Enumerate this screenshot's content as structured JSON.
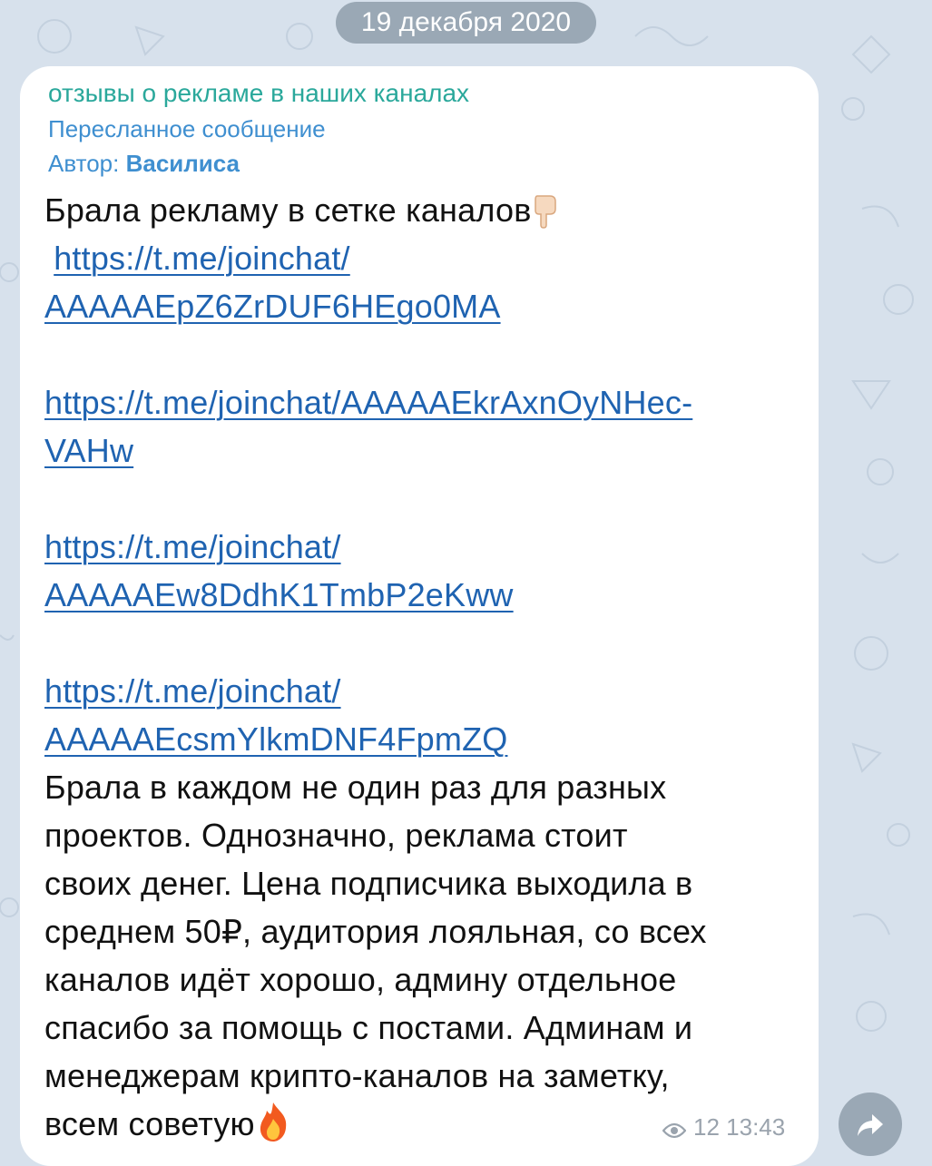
{
  "date_separator": "19 декабря 2020",
  "message": {
    "forwarded_from_channel": "отзывы о рекламе в наших каналах",
    "forwarded_label": "Пересланное сообщение",
    "author_prefix": "Автор: ",
    "author_name": "Василиса",
    "lines": [
      {
        "text": "Брала рекламу в сетке каналов",
        "type": "text",
        "emoji": "pointing-down-hand"
      },
      {
        "text": " https://t.me/joinchat/",
        "type": "link"
      },
      {
        "text": "AAAAAEpZ6ZrDUF6HEgo0MA",
        "type": "link"
      },
      {
        "text": "",
        "type": "blank"
      },
      {
        "text": "https://t.me/joinchat/AAAAAEkrAxnOyNHec-",
        "type": "link"
      },
      {
        "text": "VAHw",
        "type": "link"
      },
      {
        "text": "",
        "type": "blank"
      },
      {
        "text": "https://t.me/joinchat/",
        "type": "link"
      },
      {
        "text": "AAAAAEw8DdhK1TmbP2eKww",
        "type": "link"
      },
      {
        "text": "",
        "type": "blank"
      },
      {
        "text": "https://t.me/joinchat/",
        "type": "link"
      },
      {
        "text": "AAAAAEcsmYlkmDNF4FpmZQ",
        "type": "link"
      },
      {
        "text": " Брала в каждом не один раз для разных",
        "type": "text"
      },
      {
        "text": "проектов. Однозначно, реклама стоит",
        "type": "text"
      },
      {
        "text": "своих денег. Цена подписчика выходила в",
        "type": "text"
      },
      {
        "text": "среднем 50₽, аудитория лояльная, со всех",
        "type": "text"
      },
      {
        "text": "каналов идёт хорошо, админу отдельное",
        "type": "text"
      },
      {
        "text": "спасибо за помощь с постами. Админам и",
        "type": "text"
      },
      {
        "text": "менеджерам крипто-каналов  на заметку,",
        "type": "text"
      },
      {
        "text": "всем советую",
        "type": "text",
        "emoji": "fire"
      }
    ],
    "views": "12",
    "time": "13:43",
    "views_icon": "eye-icon"
  },
  "share_button_icon": "share-arrow-icon",
  "colors": {
    "background": "#d7e1ec",
    "bubble": "#ffffff",
    "channel_name": "#2aa89b",
    "forward_meta": "#3f8fd0",
    "link": "#1f63b1",
    "pill": "#9aa8b5"
  }
}
